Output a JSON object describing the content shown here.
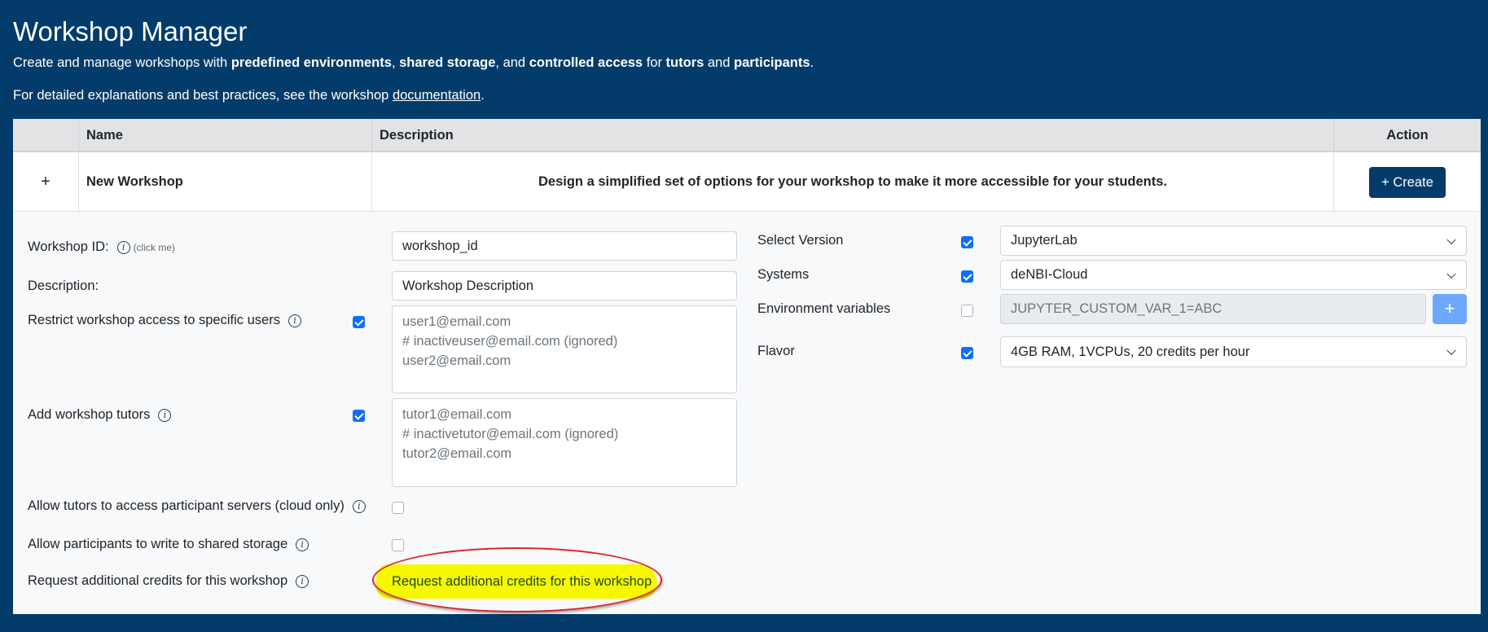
{
  "header": {
    "title": "Workshop Manager",
    "subtitle_parts": [
      "Create and manage workshops with ",
      "predefined environments",
      ", ",
      "shared storage",
      ", and ",
      "controlled access",
      " for ",
      "tutors",
      " and ",
      "participants",
      "."
    ],
    "doc_prefix": "For detailed explanations and best practices, see the workshop ",
    "doc_link": "documentation",
    "doc_suffix": "."
  },
  "table": {
    "headers": {
      "name": "Name",
      "description": "Description",
      "action": "Action"
    },
    "row": {
      "expand": "+",
      "name": "New Workshop",
      "description": "Design a simplified set of options for your workshop to make it more accessible for your students.",
      "create": "+ Create"
    }
  },
  "form": {
    "workshop_id": {
      "label": "Workshop ID:",
      "hint": "(click me)",
      "value": "workshop_id"
    },
    "description": {
      "label": "Description:",
      "value": "Workshop Description"
    },
    "restrict": {
      "label": "Restrict workshop access to specific users",
      "checked": true,
      "value": "user1@email.com\n# inactiveuser@email.com (ignored)\nuser2@email.com"
    },
    "tutors": {
      "label": "Add workshop tutors",
      "checked": true,
      "value": "tutor1@email.com\n# inactivetutor@email.com (ignored)\ntutor2@email.com"
    },
    "tutor_access": {
      "label": "Allow tutors to access participant servers (cloud only)",
      "checked": false
    },
    "write_storage": {
      "label": "Allow participants to write to shared storage",
      "checked": false
    },
    "credits": {
      "label": "Request additional credits for this workshop",
      "button": "Request additional credits for this workshop"
    },
    "version": {
      "label": "Select Version",
      "checked": true,
      "value": "JupyterLab"
    },
    "systems": {
      "label": "Systems",
      "checked": true,
      "value": "deNBI-Cloud"
    },
    "env": {
      "label": "Environment variables",
      "checked": false,
      "placeholder": "JUPYTER_CUSTOM_VAR_1=ABC",
      "add": "+"
    },
    "flavor": {
      "label": "Flavor",
      "checked": true,
      "value": "4GB RAM, 1VCPUs, 20 credits per hour"
    }
  }
}
